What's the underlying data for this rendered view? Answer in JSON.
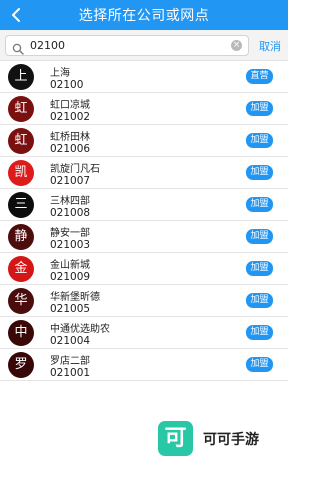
{
  "header": {
    "title": "选择所在公司或网点",
    "back_icon": "back-chevron-icon"
  },
  "search": {
    "value": "02100",
    "placeholder": "",
    "cancel_label": "取消"
  },
  "colors": {
    "accent": "#2196f3",
    "watermark": "#28c7a5"
  },
  "items": [
    {
      "avatar": "上",
      "name": "上海",
      "code": "02100",
      "badge": "直营",
      "color": "#111111"
    },
    {
      "avatar": "虹",
      "name": "虹口凉城",
      "code": "021002",
      "badge": "加盟",
      "color": "#7a1010"
    },
    {
      "avatar": "虹",
      "name": "虹桥田林",
      "code": "021006",
      "badge": "加盟",
      "color": "#7a1010"
    },
    {
      "avatar": "凯",
      "name": "凯旋门凡石",
      "code": "021007",
      "badge": "加盟",
      "color": "#dd1b1b"
    },
    {
      "avatar": "三",
      "name": "三林四部",
      "code": "021008",
      "badge": "加盟",
      "color": "#0d0d0d"
    },
    {
      "avatar": "静",
      "name": "静安一部",
      "code": "021003",
      "badge": "加盟",
      "color": "#4d0d0d"
    },
    {
      "avatar": "金",
      "name": "金山新城",
      "code": "021009",
      "badge": "加盟",
      "color": "#d41616"
    },
    {
      "avatar": "华",
      "name": "华新堡昕德",
      "code": "021005",
      "badge": "加盟",
      "color": "#4a0c0c"
    },
    {
      "avatar": "中",
      "name": "中通优选助农",
      "code": "021004",
      "badge": "加盟",
      "color": "#3b0808"
    },
    {
      "avatar": "罗",
      "name": "罗店二部",
      "code": "021001",
      "badge": "加盟",
      "color": "#380707"
    }
  ],
  "watermark": {
    "logo_char": "可",
    "text": "可可手游"
  }
}
